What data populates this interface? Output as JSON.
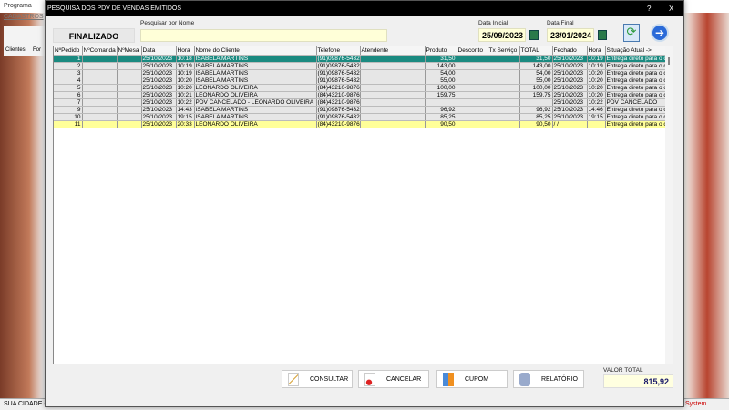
{
  "app": {
    "title": "Programa",
    "menu": "CADASTROS",
    "icons": [
      "Clientes",
      "For"
    ],
    "status_left": "SUA CIDADE -",
    "status_right": "System"
  },
  "dialog": {
    "title": "PESQUISA DOS PDV DE VENDAS EMITIDOS",
    "help": "?",
    "close": "X",
    "status_button": "FINALIZADO",
    "search_label": "Pesquisar por Nome",
    "search_value": "",
    "date_start_label": "Data Inicial",
    "date_start": "25/09/2023",
    "date_end_label": "Data Final",
    "date_end": "23/01/2024",
    "columns": [
      "NºPedido",
      "NºComanda",
      "NºMesa",
      "Data",
      "Hora",
      "Nome do Cliente",
      "Telefone",
      "Atendente",
      "Produto",
      "Desconto",
      "Tx Serviço",
      "TOTAL",
      "Fechado",
      "Hora",
      "Situação Atual ->"
    ],
    "rows": [
      [
        "1",
        "",
        "",
        "25/10/2023",
        "10:18",
        "ISABELA MARTINS",
        "(91)09876-5432",
        "",
        "31,50",
        "",
        "",
        "31,50",
        "25/10/2023",
        "10:19",
        "Entrega direto para o cli"
      ],
      [
        "2",
        "",
        "",
        "25/10/2023",
        "10:19",
        "ISABELA MARTINS",
        "(91)09876-5432",
        "",
        "143,00",
        "",
        "",
        "143,00",
        "25/10/2023",
        "10:19",
        "Entrega direto para o cli"
      ],
      [
        "3",
        "",
        "",
        "25/10/2023",
        "10:19",
        "ISABELA MARTINS",
        "(91)09876-5432",
        "",
        "54,00",
        "",
        "",
        "54,00",
        "25/10/2023",
        "10:20",
        "Entrega direto para o cli"
      ],
      [
        "4",
        "",
        "",
        "25/10/2023",
        "10:20",
        "ISABELA MARTINS",
        "(91)09876-5432",
        "",
        "55,00",
        "",
        "",
        "55,00",
        "25/10/2023",
        "10:20",
        "Entrega direto para o cli"
      ],
      [
        "5",
        "",
        "",
        "25/10/2023",
        "10:20",
        "LEONARDO OLIVEIRA",
        "(84)43210-9876",
        "",
        "100,00",
        "",
        "",
        "100,00",
        "25/10/2023",
        "10:20",
        "Entrega direto para o cli"
      ],
      [
        "6",
        "",
        "",
        "25/10/2023",
        "10:21",
        "LEONARDO OLIVEIRA",
        "(84)43210-9876",
        "",
        "159,75",
        "",
        "",
        "159,75",
        "25/10/2023",
        "10:20",
        "Entrega direto para o cli"
      ],
      [
        "7",
        "",
        "",
        "25/10/2023",
        "10:22",
        "PDV CANCELADO - LEONARDO OLIVEIRA",
        "(84)43210-9876",
        "",
        "",
        "",
        "",
        "",
        "25/10/2023",
        "10:22",
        "PDV CANCELADO"
      ],
      [
        "9",
        "",
        "",
        "25/10/2023",
        "14:43",
        "ISABELA MARTINS",
        "(91)09876-5432",
        "",
        "96,92",
        "",
        "",
        "96,92",
        "25/10/2023",
        "14:46",
        "Entrega direto para o cli"
      ],
      [
        "10",
        "",
        "",
        "25/10/2023",
        "19:15",
        "ISABELA MARTINS",
        "(91)09876-5432",
        "",
        "85,25",
        "",
        "",
        "85,25",
        "25/10/2023",
        "19:15",
        "Entrega direto para o cli"
      ],
      [
        "11",
        "",
        "",
        "25/10/2023",
        "20:33",
        "LEONARDO OLIVEIRA",
        "(84)43210-9876",
        "",
        "90,50",
        "",
        "",
        "90,50",
        " /  /",
        "",
        "Entrega direto para o cli"
      ]
    ],
    "buttons": {
      "consultar": "CONSULTAR",
      "cancelar": "CANCELAR",
      "cupom": "CUPOM",
      "relatorio": "RELATÓRIO"
    },
    "total_label": "VALOR TOTAL",
    "total_value": "815,92"
  }
}
